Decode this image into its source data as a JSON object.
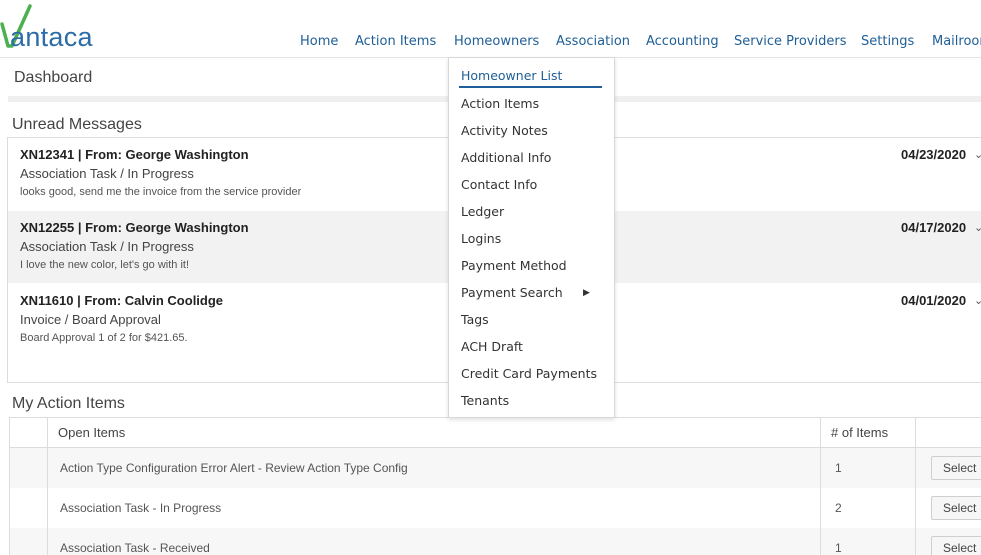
{
  "brand": {
    "name": "Vantaca",
    "logo_text": "antaca",
    "accent": "#1f5e96",
    "logo_green": "#4caf50"
  },
  "nav": {
    "items": [
      "Home",
      "Action Items",
      "Homeowners",
      "Association",
      "Accounting",
      "Service Providers",
      "Settings",
      "Mailroom"
    ]
  },
  "dashboard": {
    "title": "Dashboard"
  },
  "unread": {
    "title": "Unread Messages",
    "messages": [
      {
        "header": "XN12341 | From: George Washington",
        "subtitle": "Association Task / In Progress",
        "body": "looks good, send me the invoice from the service provider",
        "date": "04/23/2020"
      },
      {
        "header": "XN12255 | From: George Washington",
        "subtitle": "Association Task / In Progress",
        "body": "I love the new color, let's go with it!",
        "date": "04/17/2020"
      },
      {
        "header": "XN11610 | From: Calvin Coolidge",
        "subtitle": "Invoice / Board Approval",
        "body": "Board Approval 1 of 2 for $421.65.",
        "date": "04/01/2020"
      }
    ]
  },
  "action_items": {
    "title": "My Action Items",
    "columns": {
      "open": "Open Items",
      "count": "# of Items"
    },
    "rows": [
      {
        "name": "Action Type Configuration Error Alert - Review Action Type Config",
        "count": "1",
        "button": "Select"
      },
      {
        "name": "Association Task - In Progress",
        "count": "2",
        "button": "Select"
      },
      {
        "name": "Association Task - Received",
        "count": "1",
        "button": "Select"
      }
    ]
  },
  "dropdown": {
    "items": [
      "Homeowner List",
      "Action Items",
      "Activity Notes",
      "Additional Info",
      "Contact Info",
      "Ledger",
      "Logins",
      "Payment Method",
      "Payment Search",
      "Tags",
      "ACH Draft",
      "Credit Card Payments",
      "Tenants"
    ],
    "active": "Homeowner List",
    "submenu_icon": "caret-right-icon"
  }
}
